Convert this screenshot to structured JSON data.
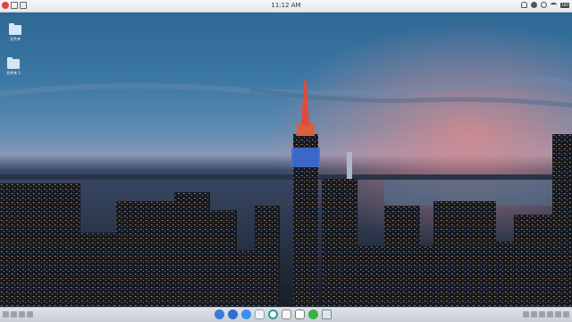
{
  "topbar": {
    "time": "11:12 AM",
    "battery": "100"
  },
  "desktop": {
    "icons": [
      {
        "label": "文件夹",
        "icon": "folder-icon"
      },
      {
        "label": "文件夹 2",
        "icon": "folder-icon"
      }
    ]
  },
  "dock": {
    "apps": [
      {
        "name": "launcher",
        "icon": "launcher-icon"
      },
      {
        "name": "finder",
        "icon": "finder-icon"
      },
      {
        "name": "browser",
        "icon": "browser-icon"
      },
      {
        "name": "file-manager",
        "icon": "file-manager-icon"
      },
      {
        "name": "chrome",
        "icon": "chrome-icon"
      },
      {
        "name": "document-viewer",
        "icon": "document-icon"
      },
      {
        "name": "text-editor",
        "icon": "edit-icon"
      },
      {
        "name": "wechat",
        "icon": "wechat-icon"
      },
      {
        "name": "trash",
        "icon": "trash-icon"
      }
    ]
  },
  "colors": {
    "sky_top": "#2e6a96",
    "sky_mid": "#5d8fb5",
    "sky_pink": "#c87a8a",
    "city_dark": "#131822",
    "city_light": "#f2a94a"
  }
}
